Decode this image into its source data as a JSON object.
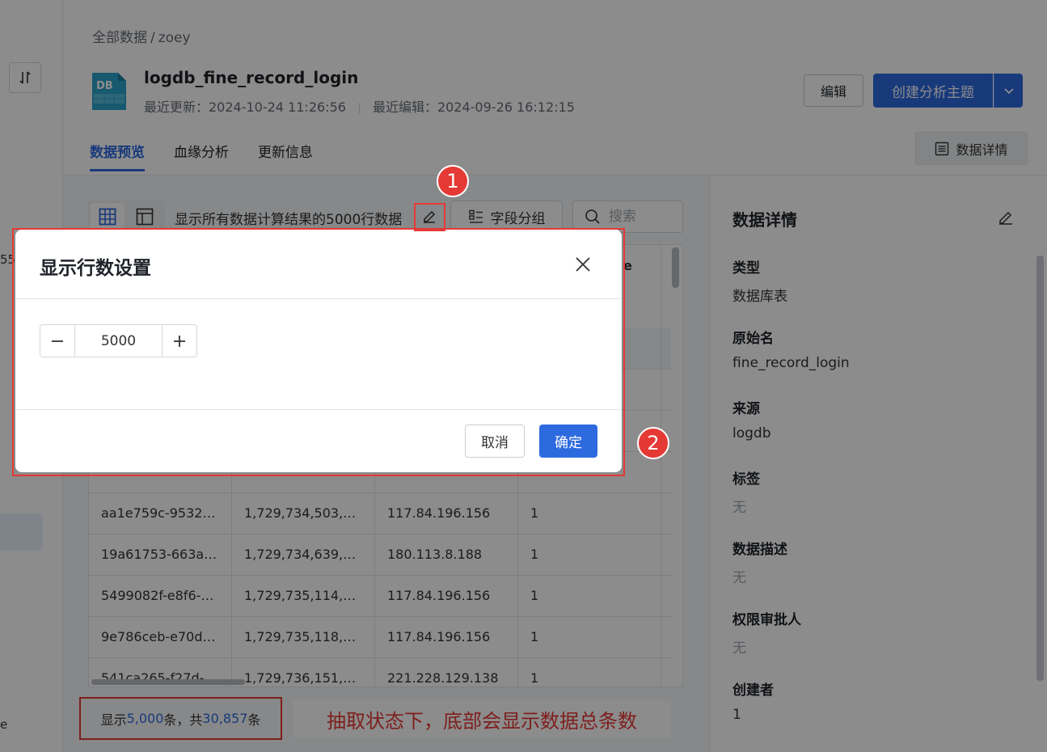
{
  "leftnav": {
    "fragment_top": "55",
    "fragment_bottom": "e"
  },
  "breadcrumb": {
    "root": "全部数据",
    "separator": "/",
    "current": "zoey"
  },
  "dataset": {
    "title": "logdb_fine_record_login",
    "updated": "最近更新：2024-10-24 11:26:56",
    "edited": "最近编辑：2024-09-26 16:12:15",
    "icon_label": "DB"
  },
  "header_actions": {
    "edit": "编辑",
    "create_topic": "创建分析主题"
  },
  "tabs": [
    {
      "label": "数据预览",
      "active": true
    },
    {
      "label": "血缘分析",
      "active": false
    },
    {
      "label": "更新信息",
      "active": false
    }
  ],
  "detail_button": "数据详情",
  "toolbar": {
    "info_text": "显示所有数据计算结果的5000行数据",
    "field_group": "字段分组",
    "search_placeholder": "搜索"
  },
  "table": {
    "header_fragment": "e",
    "rows": [
      [
        "aa1e759c-9532…",
        "1,729,734,503,…",
        "117.84.196.156",
        "1"
      ],
      [
        "19a61753-663a…",
        "1,729,734,639,…",
        "180.113.8.188",
        "1"
      ],
      [
        "5499082f-e8f6-…",
        "1,729,735,114,…",
        "117.84.196.156",
        "1"
      ],
      [
        "9e786ceb-e70d…",
        "1,729,735,118,…",
        "117.84.196.156",
        "1"
      ],
      [
        "541ca265-f27d-…",
        "1,729,736,151,…",
        "221.228.129.138",
        "1"
      ]
    ]
  },
  "footer": {
    "shown_prefix": "显示",
    "shown_count": "5,000",
    "middle": "条，共",
    "total_count": "30,857",
    "suffix": "条"
  },
  "annotation_text": "抽取状态下，底部会显示数据总条数",
  "markers": [
    "1",
    "2"
  ],
  "detail_panel": {
    "title": "数据详情",
    "fields": [
      {
        "label": "类型",
        "value": "数据库表",
        "empty": false
      },
      {
        "label": "原始名",
        "value": "fine_record_login",
        "empty": false
      },
      {
        "label": "来源",
        "value": "logdb",
        "empty": false
      },
      {
        "label": "标签",
        "value": "无",
        "empty": true
      },
      {
        "label": "数据描述",
        "value": "无",
        "empty": true
      },
      {
        "label": "权限审批人",
        "value": "无",
        "empty": true
      },
      {
        "label": "创建者",
        "value": "1",
        "empty": false
      }
    ]
  },
  "dialog": {
    "title": "显示行数设置",
    "row_count": "5000",
    "cancel": "取消",
    "confirm": "确定"
  },
  "colors": {
    "primary": "#2d6ae0",
    "annotation_red": "#e53935"
  }
}
